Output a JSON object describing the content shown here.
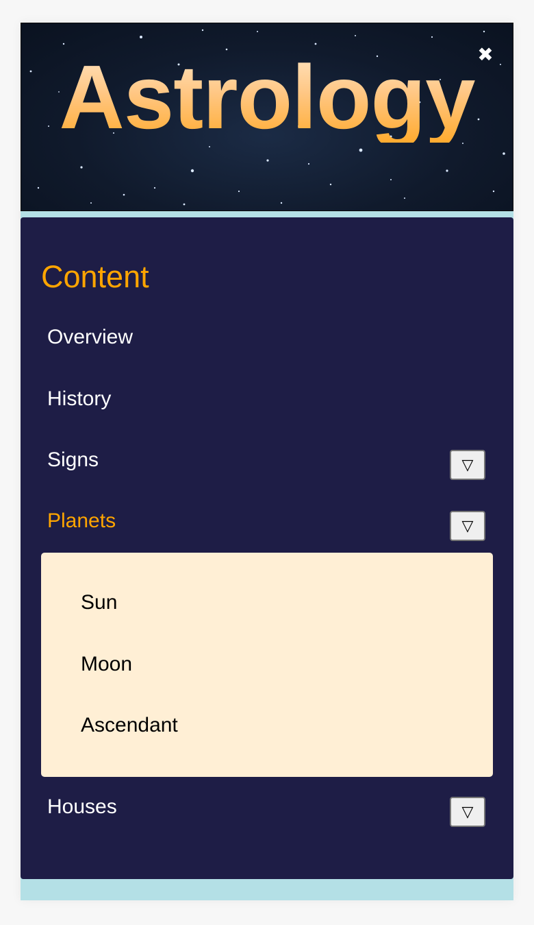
{
  "header": {
    "title": "Astrology",
    "close_icon": "✖"
  },
  "nav": {
    "heading": "Content",
    "items": [
      {
        "label": "Overview"
      },
      {
        "label": "History"
      },
      {
        "label": "Signs",
        "toggle": "▽"
      },
      {
        "label": "Planets",
        "toggle": "▽",
        "active": true,
        "subitems": [
          {
            "label": "Sun"
          },
          {
            "label": "Moon"
          },
          {
            "label": "Ascendant"
          }
        ]
      },
      {
        "label": "Houses",
        "toggle": "▽"
      }
    ]
  },
  "colors": {
    "panel_bg": "#1e1d46",
    "accent": "#ffa500",
    "submenu_bg": "#ffefd5",
    "page_bg": "#b4e0e6"
  }
}
